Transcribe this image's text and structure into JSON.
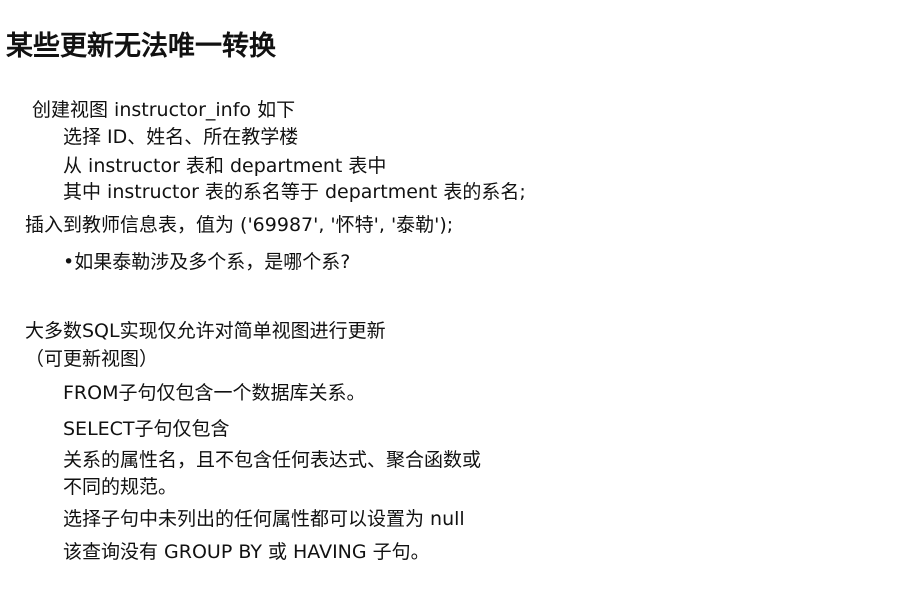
{
  "slide": {
    "title": "某些更新无法唯一转换",
    "view_example": {
      "line1": "创建视图 instructor_info 如下",
      "line2": "选择 ID、姓名、所在教学楼",
      "line3": "从 instructor 表和 department 表中",
      "line4": "其中 instructor 表的系名等于 department 表的系名;"
    },
    "insert_statement": "插入到教师信息表，值为 ('69987', '怀特', '泰勒');",
    "question": "•如果泰勒涉及多个系，是哪个系?",
    "sql_section": {
      "heading_line1": "大多数SQL实现仅允许对简单视图进行更新",
      "heading_line2": "（可更新视图）",
      "rule1": "FROM子句仅包含一个数据库关系。",
      "rule2": "SELECT子句仅包含",
      "rule3_line1": "关系的属性名，且不包含任何表达式、聚合函数或",
      "rule3_line2": "不同的规范。",
      "rule4": "选择子句中未列出的任何属性都可以设置为 null",
      "rule5": "该查询没有 GROUP BY 或 HAVING 子句。"
    }
  }
}
